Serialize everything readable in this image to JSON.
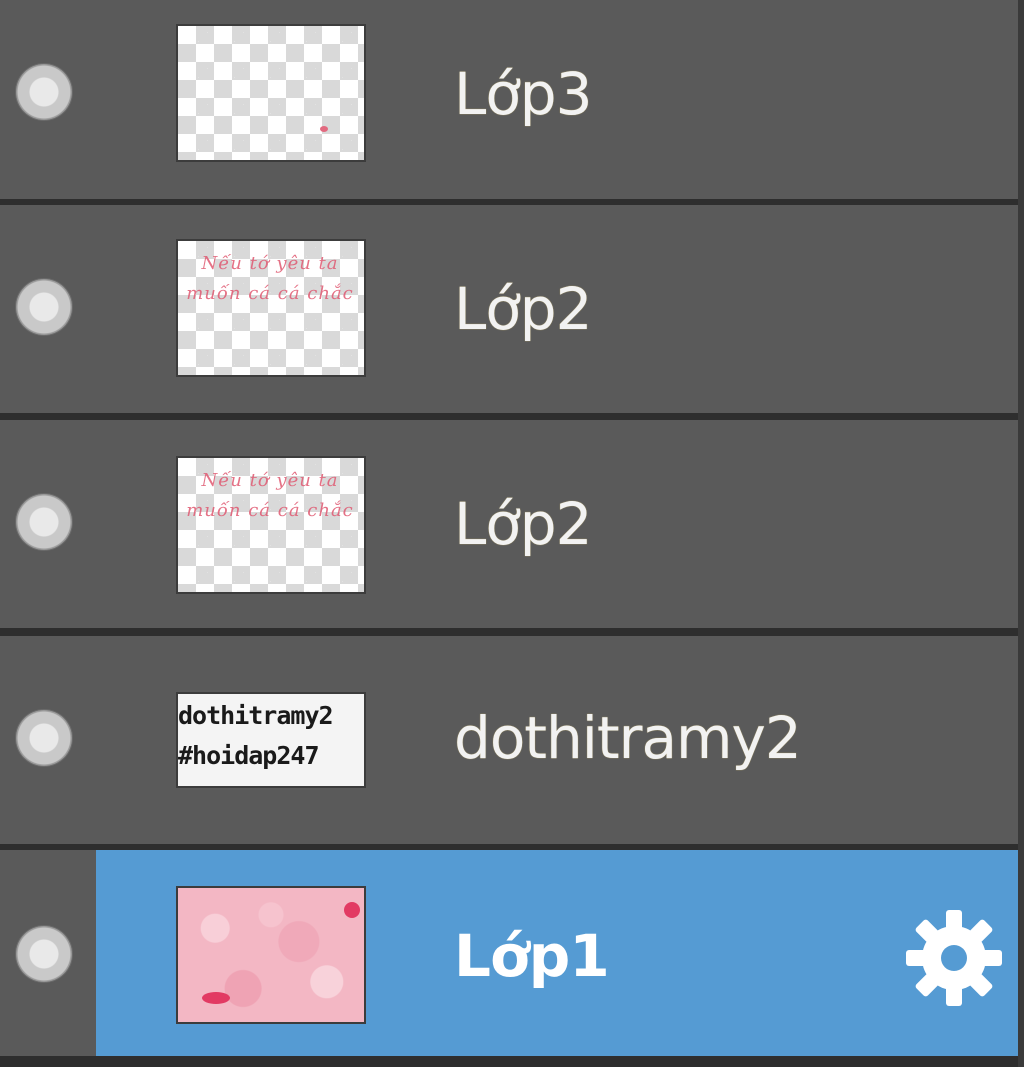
{
  "layers": [
    {
      "name": "Lớp3",
      "selected": false,
      "thumbnail": "transparent-checker"
    },
    {
      "name": "Lớp2",
      "selected": false,
      "thumbnail": "pink-handwriting",
      "thumb_text": "Nếu tớ yêu ta muốn cá cá chắc"
    },
    {
      "name": "Lớp2",
      "selected": false,
      "thumbnail": "pink-handwriting",
      "thumb_text": "Nếu tớ yêu ta muốn cá cá chắc"
    },
    {
      "name": "dothitramy2",
      "selected": false,
      "thumbnail": "text-signature",
      "thumb_line_1": "dothitramy2",
      "thumb_line_2": "#hoidap247"
    },
    {
      "name": "Lớp1",
      "selected": true,
      "thumbnail": "pink-paint",
      "settings_icon": "gear-icon"
    }
  ],
  "colors": {
    "panel_bg": "#2e2e2e",
    "row_bg": "#5a5a5a",
    "selected_bg": "#559bd3",
    "text": "#f2f2f2"
  }
}
